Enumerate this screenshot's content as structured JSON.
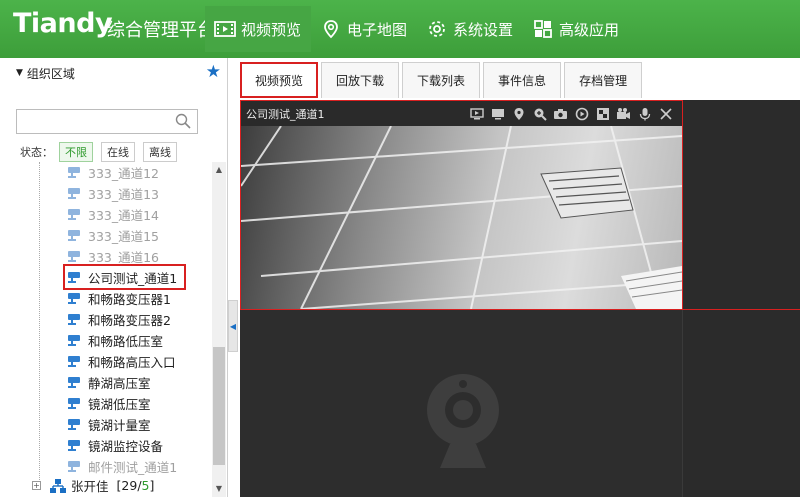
{
  "header": {
    "logo": "Tiandy",
    "title": "综合管理平台",
    "nav": [
      {
        "label": "视频预览",
        "icon": "film-icon",
        "active": true
      },
      {
        "label": "电子地图",
        "icon": "map-pin-icon",
        "active": false
      },
      {
        "label": "系统设置",
        "icon": "gear-icon",
        "active": false
      },
      {
        "label": "高级应用",
        "icon": "grid-apps-icon",
        "active": false
      }
    ]
  },
  "sidebar": {
    "org_title": "组织区域",
    "search_placeholder": "",
    "status_label": "状态：",
    "filters": [
      "不限",
      "在线",
      "离线"
    ],
    "active_filter": "不限",
    "tree": [
      {
        "label": "333_通道12",
        "online": false
      },
      {
        "label": "333_通道13",
        "online": false
      },
      {
        "label": "333_通道14",
        "online": false
      },
      {
        "label": "333_通道15",
        "online": false
      },
      {
        "label": "333_通道16",
        "online": false
      },
      {
        "label": "公司测试_通道1",
        "online": true
      },
      {
        "label": "和畅路变压器1",
        "online": true
      },
      {
        "label": "和畅路变压器2",
        "online": true
      },
      {
        "label": "和畅路低压室",
        "online": true
      },
      {
        "label": "和畅路高压入口",
        "online": true
      },
      {
        "label": "静湖高压室",
        "online": true
      },
      {
        "label": "镜湖低压室",
        "online": true
      },
      {
        "label": "镜湖计量室",
        "online": true
      },
      {
        "label": "镜湖监控设备",
        "online": true
      },
      {
        "label": "邮件测试_通道1",
        "online": false
      }
    ],
    "person": {
      "name": "张开佳",
      "count_open": "[ ",
      "online": "29",
      "sep": "/",
      "total": "5",
      "count_close": "]"
    }
  },
  "tabs": [
    {
      "label": "视频预览",
      "active": true
    },
    {
      "label": "回放下载",
      "active": false
    },
    {
      "label": "下载列表",
      "active": false
    },
    {
      "label": "事件信息",
      "active": false
    },
    {
      "label": "存档管理",
      "active": false
    }
  ],
  "video": {
    "cell1_title": "公司测试_通道1",
    "toolbar_icons": [
      "play-screen-icon",
      "monitor-icon",
      "location-icon",
      "zoom-in-icon",
      "snapshot-icon",
      "record-icon",
      "fullscreen-icon",
      "intercom-icon",
      "microphone-icon",
      "close-icon"
    ]
  },
  "colors": {
    "header_green": "#3fa53c",
    "highlight_red": "#d82020",
    "link_blue": "#1a6fc4"
  }
}
